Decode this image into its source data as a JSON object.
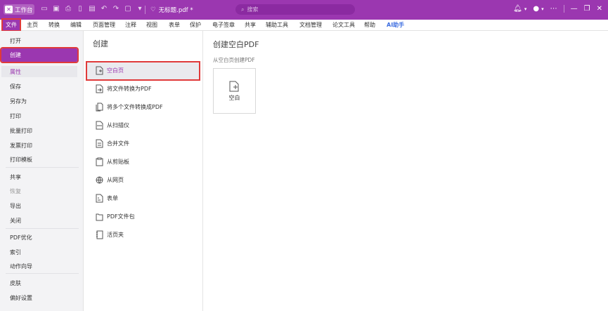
{
  "titlebar": {
    "logo_text": "工作台",
    "doc_title": "无标题.pdf *",
    "search_placeholder": "搜索"
  },
  "menu": [
    "文件",
    "主页",
    "转换",
    "编辑",
    "页面管理",
    "注释",
    "视图",
    "表单",
    "保护",
    "电子签章",
    "共享",
    "辅助工具",
    "文档管理",
    "论文工具",
    "帮助",
    "AI助手"
  ],
  "left_menu": {
    "open": "打开",
    "create": "创建",
    "properties": "属性",
    "save": "保存",
    "save_as": "另存为",
    "print": "打印",
    "batch_print": "批量打印",
    "invoice_print": "发票打印",
    "print_template": "打印模板",
    "share": "共享",
    "restore": "恢复",
    "export": "导出",
    "close": "关闭",
    "pdf_optimize": "PDF优化",
    "index": "索引",
    "action_wizard": "动作向导",
    "skin": "皮肤",
    "preferences": "偏好设置"
  },
  "create_panel": {
    "title": "创建",
    "items": [
      "空白页",
      "将文件转换为PDF",
      "将多个文件转换成PDF",
      "从扫描仪",
      "合并文件",
      "从剪贴板",
      "从网页",
      "表单",
      "PDF文件包",
      "活页夹"
    ]
  },
  "content": {
    "title": "创建空白PDF",
    "subtitle": "从空白页创建PDF",
    "card_label": "空白"
  },
  "colors": {
    "brand": "#9b37b0",
    "highlight_border": "#e03a3a",
    "ai": "#3f6fe0"
  }
}
